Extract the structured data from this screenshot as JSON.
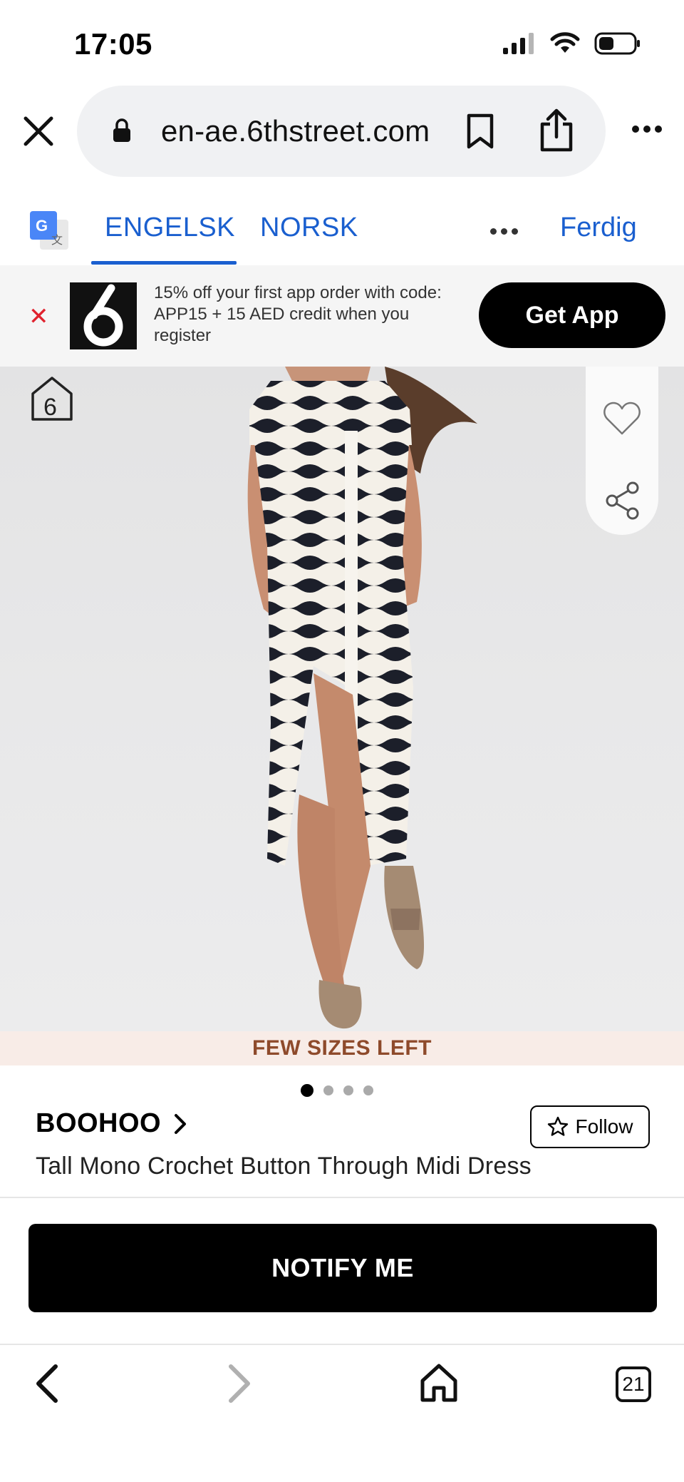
{
  "status_bar": {
    "time": "17:05"
  },
  "browser": {
    "url": "en-ae.6thstreet.com"
  },
  "translate_bar": {
    "tabs": [
      {
        "label": "ENGELSK",
        "active": true
      },
      {
        "label": "NORSK",
        "active": false
      }
    ],
    "done_label": "Ferdig"
  },
  "app_banner": {
    "message": "15% off your first app order with code: APP15 + 15 AED credit when you register",
    "button_label": "Get App",
    "logo_text": "6"
  },
  "product": {
    "home_badge": "6",
    "stock_notice": "FEW SIZES LEFT",
    "image_count": 4,
    "active_image": 1,
    "brand": "BOOHOO",
    "follow_label": "Follow",
    "title": "Tall Mono Crochet Button Through Midi Dress",
    "notify_label": "NOTIFY ME"
  },
  "bottom_nav": {
    "tab_count": "21"
  },
  "colors": {
    "accent_blue": "#1a5fcf",
    "close_red": "#e0222e",
    "stock_text": "#8e4a2b",
    "stock_bg": "#f8ece7"
  }
}
